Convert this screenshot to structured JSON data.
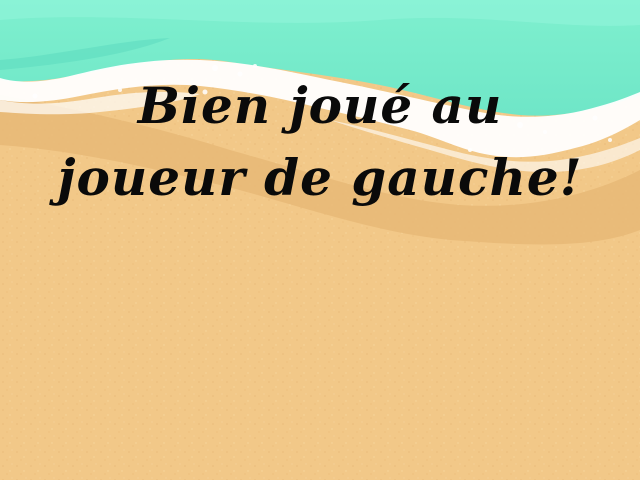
{
  "game_screen": {
    "message_line_1": "Bien joué au",
    "message_line_2": "joueur de gauche!"
  },
  "colors": {
    "sea": "#7eeccc",
    "sea_deep": "#5fdcbf",
    "foam": "#ffffff",
    "wet_sand": "#e8b877",
    "sand": "#f2c888",
    "text": "#0a0a0a"
  }
}
